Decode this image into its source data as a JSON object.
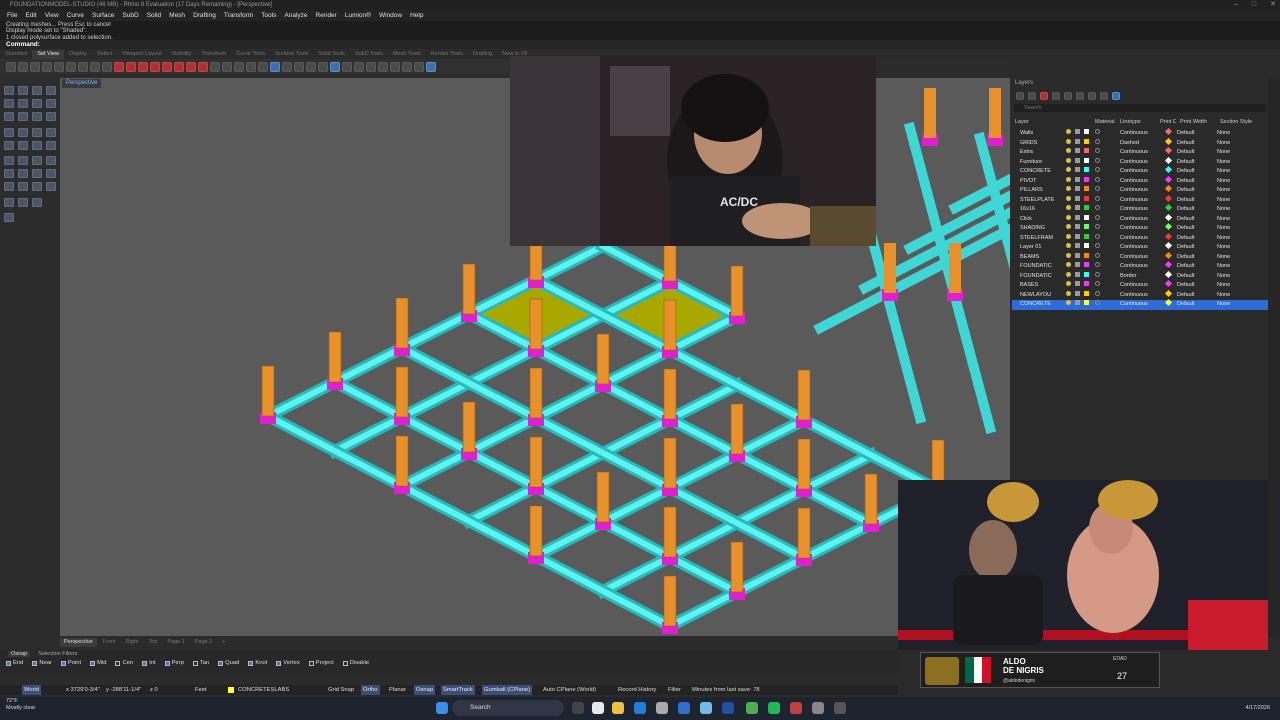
{
  "window": {
    "title": "FOUNDATIONMODEL-STUDIO (46 MB) - Rhino 8 Evaluation (17 Days Remaining) - [Perspective]",
    "controls": [
      "–",
      "□",
      "✕"
    ]
  },
  "menu": [
    "File",
    "Edit",
    "View",
    "Curve",
    "Surface",
    "SubD",
    "Solid",
    "Mesh",
    "Drafting",
    "Transform",
    "Tools",
    "Analyze",
    "Render",
    "Lumion®",
    "Window",
    "Help"
  ],
  "command_history": [
    "Creating meshes... Press Esc to cancel",
    "Display mode set to \"Shaded\".",
    "1 closed polysurface added to selection."
  ],
  "command_prompt": "Command:",
  "toolbar_tabs": [
    "Standard",
    "Set View",
    "Display",
    "Select",
    "Viewport Layout",
    "Visibility",
    "Transform",
    "Curve Tools",
    "Surface Tools",
    "Solid Tools",
    "SubD Tools",
    "Mesh Tools",
    "Render Tools",
    "Drafting",
    "New in V8"
  ],
  "toolbar_active_tab": "Set View",
  "viewport": {
    "label": "Perspective",
    "tabs": [
      "Perspective",
      "Front",
      "Right",
      "Top",
      "Page 1",
      "Page 2"
    ],
    "add_tab": "+"
  },
  "layers_panel": {
    "title": "Layers",
    "search_placeholder": "Search",
    "columns": [
      "Layer",
      "Material",
      "Linetype",
      "Print Color",
      "Print Width",
      "Section Style"
    ],
    "rows": [
      {
        "name": "Walls",
        "linetype": "Continuous",
        "print_width": "Default",
        "section": "None",
        "color": "#ffffff",
        "print_color": "#ff6666"
      },
      {
        "name": "GRIDS",
        "linetype": "Dashed",
        "print_width": "Default",
        "section": "None",
        "color": "#ffcc00",
        "print_color": "#ffcc00"
      },
      {
        "name": "Extra",
        "linetype": "Continuous",
        "print_width": "Default",
        "section": "None",
        "color": "#ff6666",
        "print_color": "#ff6666"
      },
      {
        "name": "Furniture",
        "linetype": "Continuous",
        "print_width": "Default",
        "section": "None",
        "color": "#ffffff",
        "print_color": "#ffffff"
      },
      {
        "name": "CONCRETE",
        "linetype": "Continuous",
        "print_width": "Default",
        "section": "None",
        "color": "#33ffff",
        "print_color": "#33ffff"
      },
      {
        "name": "PIVOT",
        "linetype": "Continuous",
        "print_width": "Default",
        "section": "None",
        "color": "#ff33ff",
        "print_color": "#ff33ff"
      },
      {
        "name": "PILLARS",
        "linetype": "Continuous",
        "print_width": "Default",
        "section": "None",
        "color": "#ff8800",
        "print_color": "#ff8800"
      },
      {
        "name": "STEELPLATE",
        "linetype": "Continuous",
        "print_width": "Default",
        "section": "None",
        "color": "#ff3333",
        "print_color": "#ff3333"
      },
      {
        "name": "16x16",
        "linetype": "Continuous",
        "print_width": "Default",
        "section": "None",
        "color": "#33cc33",
        "print_color": "#33cc33"
      },
      {
        "name": "Click",
        "linetype": "Continuous",
        "print_width": "Default",
        "section": "None",
        "color": "#ffffff",
        "print_color": "#ffffff"
      },
      {
        "name": "SHADING",
        "linetype": "Continuous",
        "print_width": "Default",
        "section": "None",
        "color": "#66ff66",
        "print_color": "#66ff66"
      },
      {
        "name": "STEELFRAM",
        "linetype": "Continuous",
        "print_width": "Default",
        "section": "None",
        "color": "#33cc33",
        "print_color": "#ff3333"
      },
      {
        "name": "Layer 01",
        "linetype": "Continuous",
        "print_width": "Default",
        "section": "None",
        "color": "#ffffff",
        "print_color": "#ffffff"
      },
      {
        "name": "BEAMS",
        "linetype": "Continuous",
        "print_width": "Default",
        "section": "None",
        "color": "#ff8800",
        "print_color": "#ff8800"
      },
      {
        "name": "FOUNDATIC",
        "linetype": "Continuous",
        "print_width": "Default",
        "section": "None",
        "color": "#ff33ff",
        "print_color": "#ff33ff"
      },
      {
        "name": "FOUNDATIC",
        "linetype": "Border",
        "print_width": "Default",
        "section": "None",
        "color": "#33ffff",
        "print_color": "#ffffff"
      },
      {
        "name": "BASES",
        "linetype": "Continuous",
        "print_width": "Default",
        "section": "None",
        "color": "#ff33ff",
        "print_color": "#ff33ff"
      },
      {
        "name": "NEWLAYOU",
        "linetype": "Continuous",
        "print_width": "Default",
        "section": "None",
        "color": "#ffcc00",
        "print_color": "#ffcc00"
      },
      {
        "name": "CONCRETE",
        "linetype": "Continuous",
        "print_width": "Default",
        "section": "None",
        "color": "#ffff33",
        "print_color": "#ffff33",
        "selected": true
      }
    ]
  },
  "osnap": {
    "tabs": [
      "Osnap",
      "Selection Filters"
    ],
    "items": [
      {
        "label": "End",
        "checked": true
      },
      {
        "label": "Near",
        "checked": true
      },
      {
        "label": "Point",
        "checked": true
      },
      {
        "label": "Mid",
        "checked": true
      },
      {
        "label": "Cen",
        "checked": false
      },
      {
        "label": "Int",
        "checked": true
      },
      {
        "label": "Perp",
        "checked": true
      },
      {
        "label": "Tan",
        "checked": false
      },
      {
        "label": "Quad",
        "checked": true
      },
      {
        "label": "Knot",
        "checked": true
      },
      {
        "label": "Vertex",
        "checked": true
      },
      {
        "label": "Project",
        "checked": false
      },
      {
        "label": "Disable",
        "checked": false
      }
    ]
  },
  "status_bar": {
    "cplane": "World",
    "x": "x 3729'0-3/4\"",
    "y": "y -288'11-1/4\"",
    "z": "z 0",
    "units": "Feet",
    "layer": "CONCRETESLABS",
    "layer_color": "#ffff33",
    "buttons": [
      "Grid Snap",
      "Ortho",
      "Planar",
      "Osnap",
      "SmartTrack",
      "Gumball (CPlane)"
    ],
    "active_buttons": [
      "Ortho",
      "Osnap",
      "SmartTrack",
      "Gumball (CPlane)"
    ],
    "autocplane": "Auto CPlane (World)",
    "record_history": "Record History",
    "filter": "Filter",
    "save_info": "Minutes from last save: 78"
  },
  "taskbar": {
    "weather_temp": "72°F",
    "weather_desc": "Mostly clear",
    "search_placeholder": "Search",
    "date": "4/17/2026"
  },
  "overlay": {
    "fighter_first": "ALDO",
    "fighter_last": "DE NIGRIS",
    "handle": "@aldodenigris",
    "age_label": "EDAD",
    "age": "27",
    "webcam_shirt": "AC/DC"
  }
}
